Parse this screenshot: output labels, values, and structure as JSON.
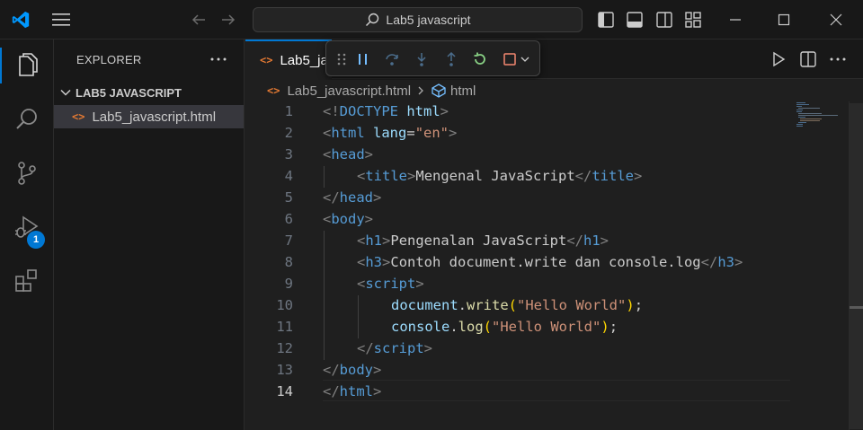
{
  "titlebar": {
    "search_text": "Lab5 javascript"
  },
  "activity": {
    "debug_badge": "1"
  },
  "sidebar": {
    "title": "EXPLORER",
    "folder_name": "LAB5 JAVASCRIPT",
    "files": [
      {
        "name": "Lab5_javascript.html",
        "icon": "html-file-icon"
      }
    ]
  },
  "editor": {
    "tab_label": "Lab5_javascript.html",
    "breadcrumb": {
      "file": "Lab5_javascript.html",
      "symbol": "html"
    },
    "current_line": 14,
    "lines": [
      {
        "number": "1"
      },
      {
        "number": "2"
      },
      {
        "number": "3"
      },
      {
        "number": "4"
      },
      {
        "number": "5"
      },
      {
        "number": "6"
      },
      {
        "number": "7"
      },
      {
        "number": "8"
      },
      {
        "number": "9"
      },
      {
        "number": "10"
      },
      {
        "number": "11"
      },
      {
        "number": "12"
      },
      {
        "number": "13"
      },
      {
        "number": "14"
      }
    ],
    "code": {
      "l1": {
        "a": "<!",
        "b": "DOCTYPE",
        "c": " html",
        "d": ">"
      },
      "l2": {
        "a": "<",
        "b": "html",
        "c": " lang",
        "d": "=",
        "e": "\"en\"",
        "f": ">"
      },
      "l3": {
        "a": "<",
        "b": "head",
        "c": ">"
      },
      "l4": {
        "a": "<",
        "b": "title",
        "c": ">",
        "d": "Mengenal JavaScript",
        "e": "</",
        "f": "title",
        "g": ">"
      },
      "l5": {
        "a": "</",
        "b": "head",
        "c": ">"
      },
      "l6": {
        "a": "<",
        "b": "body",
        "c": ">"
      },
      "l7": {
        "a": "<",
        "b": "h1",
        "c": ">",
        "d": "Pengenalan JavaScript",
        "e": "</",
        "f": "h1",
        "g": ">"
      },
      "l8": {
        "a": "<",
        "b": "h3",
        "c": ">",
        "d": "Contoh document.write dan console.log",
        "e": "</",
        "f": "h3",
        "g": ">"
      },
      "l9": {
        "a": "<",
        "b": "script",
        "c": ">"
      },
      "l10": {
        "obj": "document",
        "dot": ".",
        "fn": "write",
        "po": "(",
        "str": "\"Hello World\"",
        "pc": ")",
        "semi": ";"
      },
      "l11": {
        "obj": "console",
        "dot": ".",
        "fn": "log",
        "po": "(",
        "str": "\"Hello World\"",
        "pc": ")",
        "semi": ";"
      },
      "l12": {
        "a": "</",
        "b": "script",
        "c": ">"
      },
      "l13": {
        "a": "</",
        "b": "body",
        "c": ">"
      },
      "l14": {
        "a": "</",
        "b": "html",
        "c": ">"
      }
    }
  },
  "colors": {
    "accent": "#0078d4",
    "tag": "#569cd6",
    "attribute": "#9cdcfe",
    "string": "#ce9178",
    "function": "#dcdcaa",
    "bracket": "#ffd700",
    "html_icon": "#e37933",
    "restart_green": "#89d185",
    "stop_red": "#f48771"
  }
}
